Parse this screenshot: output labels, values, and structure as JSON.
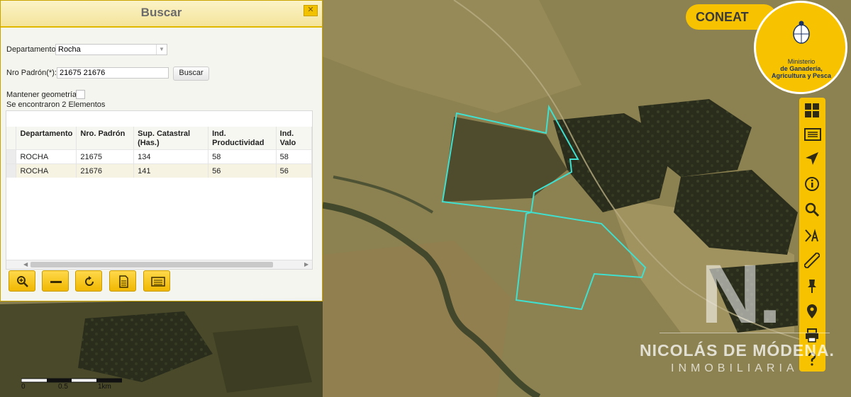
{
  "panel": {
    "title": "Buscar",
    "close_icon": "close-icon",
    "departamento_label": "Departamento",
    "departamento_value": "Rocha",
    "padron_label": "Nro Padrón(*):",
    "padron_value": "21675 21676",
    "buscar_label": "Buscar",
    "mantener_label": "Mantener geometría",
    "mantener_checked": false,
    "found_text": "Se encontraron 2 Elementos"
  },
  "results": {
    "columns": [
      "Departamento",
      "Nro. Padrón",
      "Sup. Catastral (Has.)",
      "Ind. Productividad",
      "Ind. Valo"
    ],
    "rows": [
      [
        "ROCHA",
        "21675",
        "134",
        "58",
        "58"
      ],
      [
        "ROCHA",
        "21676",
        "141",
        "56",
        "56"
      ]
    ]
  },
  "panel_tools": [
    "zoom-in-icon",
    "minus-icon",
    "refresh-icon",
    "document-icon",
    "list-icon"
  ],
  "right_toolbar": {
    "app_label": "CONEAT",
    "ministry_line1": "Ministerio",
    "ministry_line2": "de Ganadería,",
    "ministry_line3": "Agricultura y Pesca",
    "tools": [
      "grid-icon",
      "list-icon",
      "navigate-icon",
      "info-icon",
      "search-icon",
      "text-tool-icon",
      "ruler-icon",
      "pin-icon",
      "location-icon",
      "print-icon",
      "help-icon"
    ]
  },
  "watermark": {
    "logo": "N.",
    "name": "NICOLÁS DE MÓDENA.",
    "subtitle": "INMOBILIARIA"
  },
  "scale": {
    "labels": [
      "0",
      "0.5",
      "1km"
    ]
  },
  "colors": {
    "accent": "#f7c300",
    "parcel_outline": "#3fe0d0"
  }
}
